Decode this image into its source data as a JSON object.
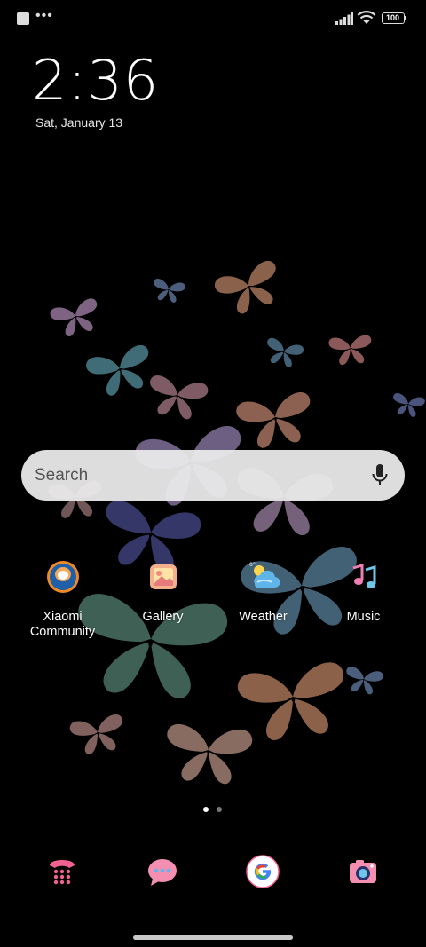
{
  "status_bar": {
    "battery_level": "100"
  },
  "clock": {
    "time": "2:36",
    "date": "Sat, January 13"
  },
  "search": {
    "placeholder": "Search"
  },
  "apps": [
    {
      "label": "Xiaomi\nCommunity",
      "icon": "xiaomi-community-icon"
    },
    {
      "label": "Gallery",
      "icon": "gallery-icon"
    },
    {
      "label": "Weather",
      "icon": "weather-icon"
    },
    {
      "label": "Music",
      "icon": "music-icon"
    }
  ],
  "page_indicator": {
    "total_pages": 2,
    "current_page": 1
  },
  "dock": [
    {
      "icon": "phone-icon"
    },
    {
      "icon": "messages-icon"
    },
    {
      "icon": "google-icon"
    },
    {
      "icon": "camera-icon"
    }
  ],
  "colors": {
    "background": "#000000",
    "search_bar": "#ebebeb",
    "accent_pink": "#f06292"
  }
}
